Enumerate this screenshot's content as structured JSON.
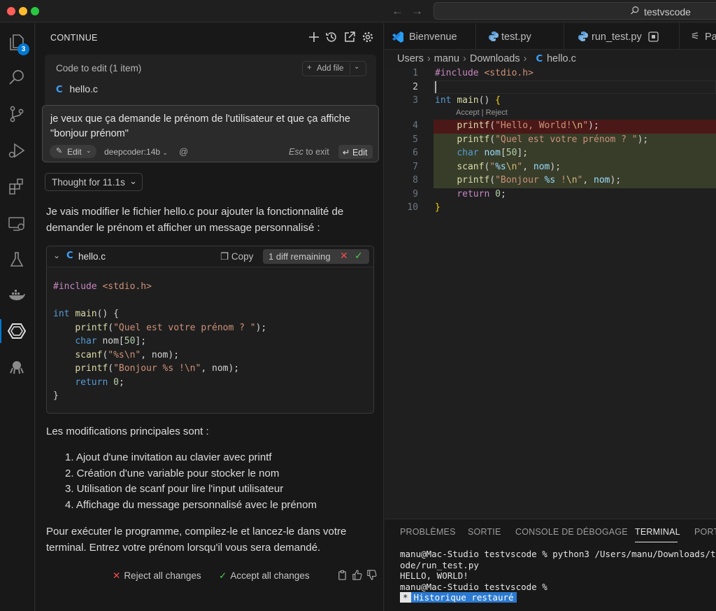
{
  "titlebar": {
    "search_text": "testvscode"
  },
  "activity": {
    "explorer_badge": "3"
  },
  "continue": {
    "title": "CONTINUE",
    "code_to_edit": "Code to edit (1 item)",
    "add_file": "Add file",
    "edit_file": "hello.c",
    "prompt": "je veux que ça demande le prénom de l'utilisateur et que ça affiche \"bonjour prénom\"",
    "mode": "Edit",
    "model": "deepcoder:14b",
    "at_symbol": "@",
    "esc_key": "Esc",
    "esc_label": "to exit",
    "submit": "↵ Edit",
    "thought": "Thought for 11.1s",
    "intro": "Je vais modifier le fichier hello.c pour ajouter la fonctionnalité de demander le prénom et afficher un message personnalisé :",
    "codeblock": {
      "filename": "hello.c",
      "copy": "Copy",
      "diff_status": "1 diff remaining"
    },
    "summary_title": "Les modifications principales sont :",
    "summary_items": [
      "1. Ajout d'une invitation au clavier avec printf",
      "2. Création d'une variable pour stocker le nom",
      "3. Utilisation de scanf pour lire l'input utilisateur",
      "4. Affichage du message personnalisé avec le prénom"
    ],
    "closing": "Pour exécuter le programme, compilez-le et lancez-le dans votre terminal. Entrez votre prénom lorsqu'il vous sera demandé.",
    "reject_all": "Reject all changes",
    "accept_all": "Accept all changes"
  },
  "tabs": [
    {
      "label": "Bienvenue",
      "icon": "vscode-icon"
    },
    {
      "label": "test.py",
      "icon": "python-icon"
    },
    {
      "label": "run_test.py",
      "icon": "python-icon"
    },
    {
      "label": "Pa",
      "icon": "settings-icon"
    }
  ],
  "breadcrumb": [
    "Users",
    "manu",
    "Downloads",
    "hello.c"
  ],
  "editor": {
    "line_numbers": [
      "1",
      "2",
      "3",
      "4",
      "5",
      "6",
      "7",
      "8",
      "9",
      "10"
    ],
    "codelens": "Accept | Reject"
  },
  "panel": {
    "tabs": [
      "PROBLÈMES",
      "SORTIE",
      "CONSOLE DE DÉBOGAGE",
      "TERMINAL",
      "PORT"
    ],
    "terminal_lines": [
      "manu@Mac-Studio testvscode % python3 /Users/manu/Downloads/te",
      "ode/run_test.py",
      "HELLO, WORLD!",
      "manu@Mac-Studio testvscode %"
    ],
    "restore_marker": "*",
    "restore_msg": "Historique restauré"
  },
  "colors": {
    "accent": "#0078d4",
    "deleted_line": "#4b1818",
    "added_line": "#373d29",
    "reject": "#f14c4c",
    "accept": "#4ec94e"
  }
}
